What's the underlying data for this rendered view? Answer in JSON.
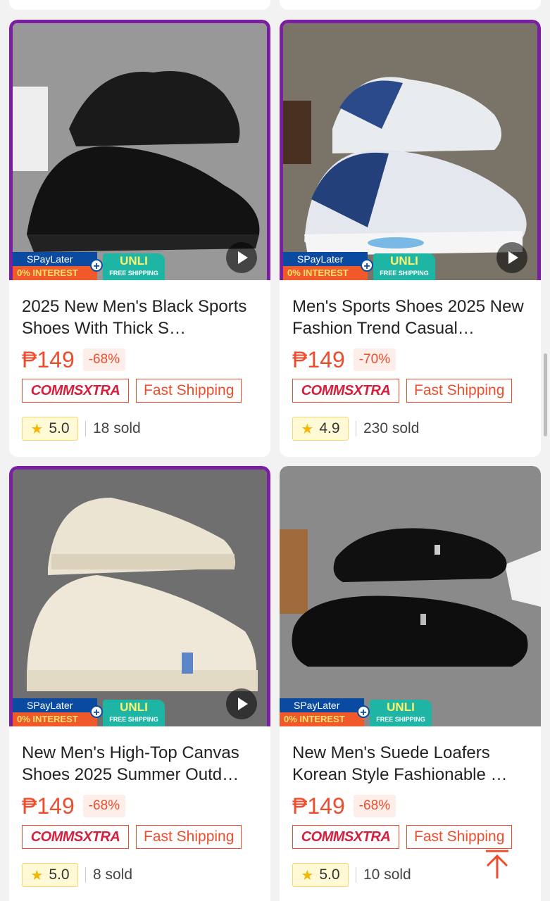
{
  "products": [
    {
      "title": "2025 New Men's Black Sports Shoes With Thick S…",
      "price": "₱149",
      "discount": "-68%",
      "rating": "5.0",
      "sold": "18 sold",
      "framed": true,
      "shoe_color": "#151515"
    },
    {
      "title": "Men's Sports Shoes 2025 New Fashion Trend Casual…",
      "price": "₱149",
      "discount": "-70%",
      "rating": "4.9",
      "sold": "230 sold",
      "framed": true,
      "shoe_color": "#e8ecf2"
    },
    {
      "title": "New Men's High-Top Canvas Shoes 2025 Summer Outd…",
      "price": "₱149",
      "discount": "-68%",
      "rating": "5.0",
      "sold": "8 sold",
      "framed": true,
      "shoe_color": "#ece4d2"
    },
    {
      "title": "New Men's Suede Loafers Korean Style Fashionable …",
      "price": "₱149",
      "discount": "-68%",
      "rating": "5.0",
      "sold": "10 sold",
      "framed": false,
      "shoe_color": "#0e0e0e"
    }
  ],
  "badges": {
    "spaylater": "SPayLater",
    "interest": "0% INTEREST",
    "unli": "UNLI",
    "free_shipping": "FREE SHIPPING",
    "comms_a": "COMMS",
    "comms_b": "XTRA",
    "fast_shipping": "Fast Shipping"
  },
  "icons": {
    "star": "star-icon",
    "play": "play-icon",
    "back_to_top": "arrow-up-icon"
  },
  "colors": {
    "accent": "#ee4d2d",
    "frame": "#7b1fa2",
    "page_bg": "#f2f2f2"
  }
}
